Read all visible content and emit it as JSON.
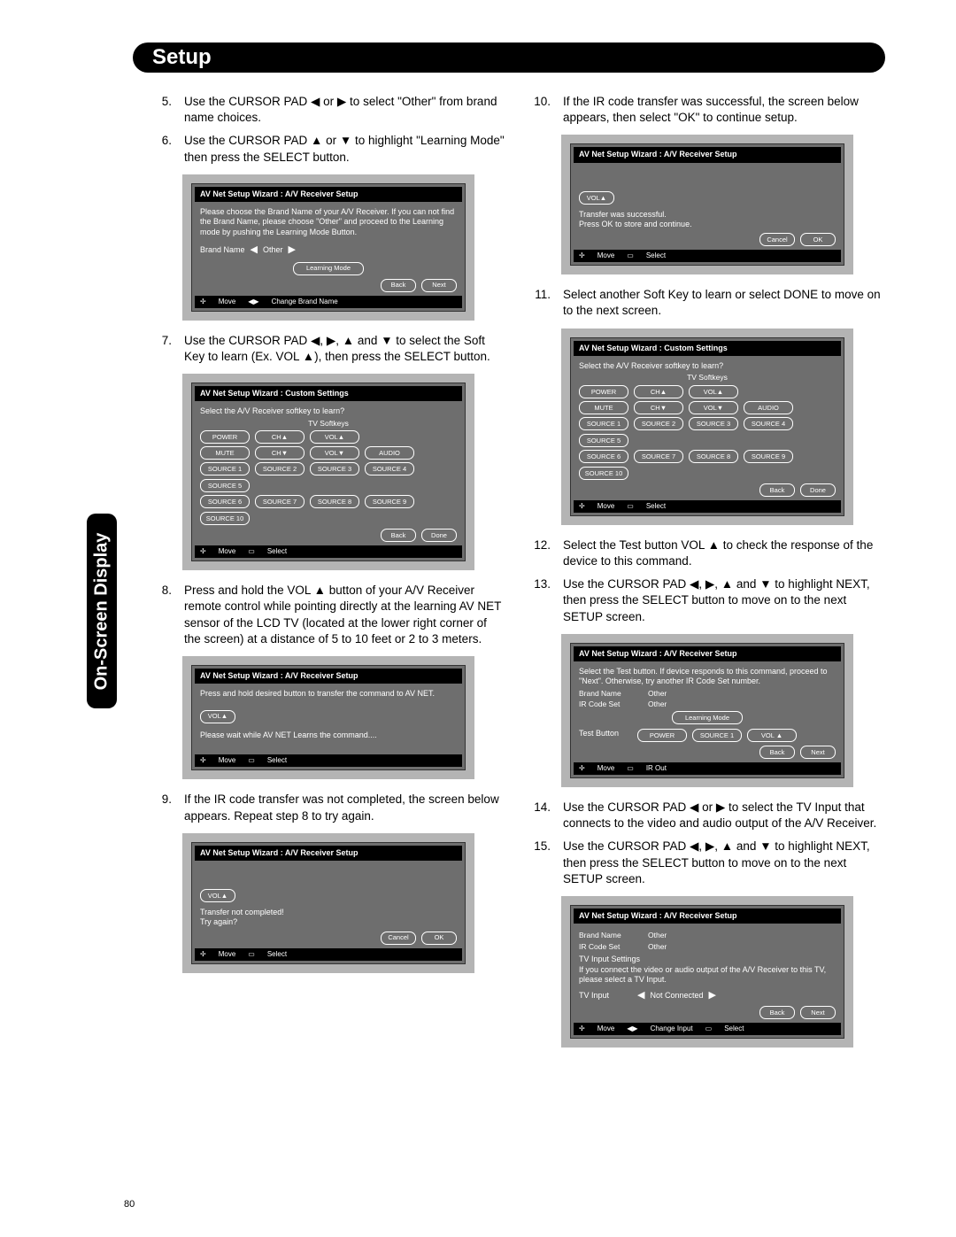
{
  "page_number": "80",
  "header_title": "Setup",
  "side_tab": "On-Screen Display",
  "arrows": {
    "l": "◀",
    "r": "▶",
    "u": "▲",
    "d": "▼"
  },
  "steps": {
    "s5": "Use the CURSOR PAD  ◀ or ▶ to select \"Other\" from brand name choices.",
    "s6": "Use the CURSOR PAD ▲ or ▼ to highlight \"Learning Mode\" then press the SELECT button.",
    "s7": "Use the CURSOR PAD ◀, ▶, ▲ and ▼ to select the Soft Key to learn (Ex. VOL ▲), then press the SELECT button.",
    "s8": "Press and hold the VOL ▲ button of your A/V Receiver remote control while pointing directly at the learning AV NET sensor of the LCD TV (located at the lower right corner of the screen) at a distance of 5 to 10 feet or 2 to 3 meters.",
    "s9": "If the IR code transfer was not completed, the screen below appears.  Repeat step 8 to try again.",
    "s10": "If the IR code transfer was successful, the screen below appears, then select \"OK\" to continue setup.",
    "s11": "Select another Soft Key to learn or select DONE to move on to the next screen.",
    "s12": "Select the Test button VOL ▲ to check the response of the device to this command.",
    "s13": "Use the CURSOR PAD ◀, ▶, ▲ and ▼ to highlight NEXT, then press the SELECT button to move on to the next SETUP screen.",
    "s14": "Use the CURSOR PAD ◀ or ▶ to select the TV Input that connects to the video and audio output of the A/V Receiver.",
    "s15": "Use the CURSOR PAD ◀, ▶, ▲ and ▼ to highlight NEXT, then press the SELECT button to move on to the next SETUP screen."
  },
  "osd": {
    "title_av": "AV Net Setup Wizard : A/V Receiver Setup",
    "title_custom": "AV Net Setup Wizard : Custom Settings",
    "panel1_msg": "Please choose the Brand Name of your A/V Receiver. If you can not find the Brand Name, please choose \"Other\" and proceed to the Learning mode by pushing the Learning Mode Button.",
    "brand_name_label": "Brand Name",
    "other": "Other",
    "learning_mode": "Learning Mode",
    "back": "Back",
    "next": "Next",
    "done": "Done",
    "cancel": "Cancel",
    "ok": "OK",
    "foot_move": "Move",
    "foot_change_brand": "Change Brand Name",
    "foot_select": "Select",
    "foot_change_input": "Change Input",
    "foot_irout": "IR Out",
    "panel2_msg": "Select the A/V Receiver softkey to learn?",
    "tv_softkeys": "TV Softkeys",
    "keys_r1": [
      "POWER",
      "CH▲",
      "VOL▲"
    ],
    "keys_r2": [
      "MUTE",
      "CH▼",
      "VOL▼",
      "AUDIO"
    ],
    "keys_r3": [
      "SOURCE 1",
      "SOURCE 2",
      "SOURCE 3",
      "SOURCE 4",
      "SOURCE 5"
    ],
    "keys_r4": [
      "SOURCE 6",
      "SOURCE 7",
      "SOURCE 8",
      "SOURCE 9",
      "SOURCE 10"
    ],
    "panel3_msg": "Press and hold desired button to transfer the command to AV NET.",
    "panel3_wait": "Please wait while AV NET Learns the command....",
    "panel4_msg": "Transfer not completed!\nTry again?",
    "panel5_msg": "Transfer was successful.\nPress OK to store and continue.",
    "panel7_msg": "Select the Test button.  If device responds to this command, proceed to \"Next\".  Otherwise, try another IR Code Set number.",
    "ir_code_set": "IR Code Set",
    "test_button": "Test Button",
    "test_keys": [
      "POWER",
      "SOURCE 1",
      "VOL ▲"
    ],
    "panel8_msg": "TV Input Settings\nIf you connect the video or audio output of the A/V Receiver to this TV, please select a TV Input.",
    "tv_input": "TV Input",
    "not_connected": "Not Connected",
    "vol_up": "VOL▲"
  }
}
